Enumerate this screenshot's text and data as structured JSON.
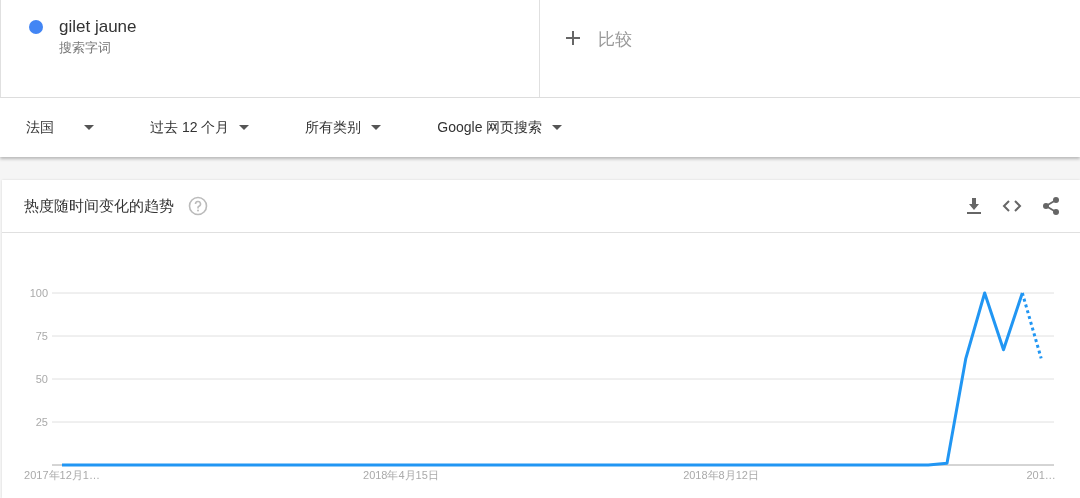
{
  "search_terms": [
    {
      "name": "gilet jaune",
      "subtitle": "搜索字词",
      "color": "#4285f4"
    }
  ],
  "compare": {
    "label": "比较"
  },
  "filters": [
    {
      "label": "法国"
    },
    {
      "label": "过去 12 个月"
    },
    {
      "label": "所有类别"
    },
    {
      "label": "Google 网页搜索"
    }
  ],
  "trend_card": {
    "title": "热度随时间变化的趋势",
    "chart_data": {
      "type": "line",
      "grid": true,
      "ylim": [
        0,
        100
      ],
      "yticks": [
        25,
        50,
        75,
        100
      ],
      "categories": [
        "2017年12月1…",
        null,
        null,
        null,
        null,
        null,
        null,
        null,
        null,
        null,
        null,
        null,
        null,
        null,
        null,
        null,
        null,
        null,
        "2018年4月15日",
        null,
        null,
        null,
        null,
        null,
        null,
        null,
        null,
        null,
        null,
        null,
        null,
        null,
        null,
        null,
        null,
        "2018年8月12日",
        null,
        null,
        null,
        null,
        null,
        null,
        null,
        null,
        null,
        null,
        null,
        null,
        null,
        null,
        null,
        null,
        "201…"
      ],
      "series": [
        {
          "color": "#2196f3",
          "values": [
            0,
            0,
            0,
            0,
            0,
            0,
            0,
            0,
            0,
            0,
            0,
            0,
            0,
            0,
            0,
            0,
            0,
            0,
            0,
            0,
            0,
            0,
            0,
            0,
            0,
            0,
            0,
            0,
            0,
            0,
            0,
            0,
            0,
            0,
            0,
            0,
            0,
            0,
            0,
            0,
            0,
            0,
            0,
            0,
            0,
            0,
            0,
            1,
            62,
            100,
            67,
            100,
            null
          ]
        },
        {
          "color": "#2196f3",
          "line_style": "dotted",
          "values": [
            null,
            null,
            null,
            null,
            null,
            null,
            null,
            null,
            null,
            null,
            null,
            null,
            null,
            null,
            null,
            null,
            null,
            null,
            null,
            null,
            null,
            null,
            null,
            null,
            null,
            null,
            null,
            null,
            null,
            null,
            null,
            null,
            null,
            null,
            null,
            null,
            null,
            null,
            null,
            null,
            null,
            null,
            null,
            null,
            null,
            null,
            null,
            null,
            null,
            null,
            null,
            100,
            62
          ]
        }
      ]
    }
  }
}
